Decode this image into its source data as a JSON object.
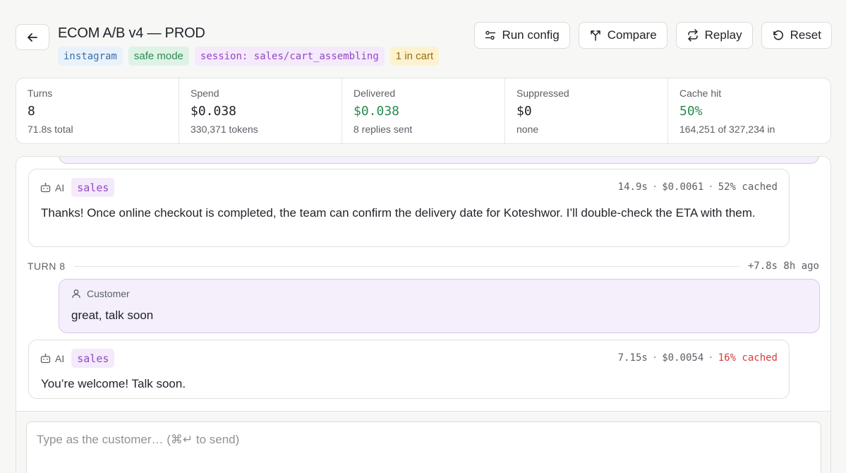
{
  "header": {
    "title": "ECOM A/B v4 — PROD",
    "tags": {
      "channel": "instagram",
      "mode": "safe mode",
      "session": "session: sales/cart_assembling",
      "cart": "1 in cart"
    },
    "actions": {
      "run_config": "Run config",
      "compare": "Compare",
      "replay": "Replay",
      "reset": "Reset"
    }
  },
  "stats": [
    {
      "label": "Turns",
      "value": "8",
      "sub": "71.8s total"
    },
    {
      "label": "Spend",
      "value": "$0.038",
      "sub": "330,371 tokens"
    },
    {
      "label": "Delivered",
      "value": "$0.038",
      "sub": "8 replies sent"
    },
    {
      "label": "Suppressed",
      "value": "$0",
      "sub": "none"
    },
    {
      "label": "Cache hit",
      "value": "50%",
      "sub": "164,251 of 327,234 in"
    }
  ],
  "colors": {
    "green_value": "#2a8a52",
    "agent_badge_text": "#9348c4",
    "customer_bubble": "#f5effc",
    "low_cache_red": "#d43b3b"
  },
  "conversation": {
    "ai_message_1": {
      "role": "AI",
      "agent": "sales",
      "duration": "14.9s",
      "cost": "$0.0061",
      "cached": "52% cached",
      "text": "Thanks! Once online checkout is completed, the team can confirm the delivery date for Koteshwor. I’ll double-check the ETA with them."
    },
    "turn": {
      "label": "TURN 8",
      "meta": "+7.8s 8h ago"
    },
    "customer_message": {
      "role": "Customer",
      "text": "great, talk soon"
    },
    "ai_message_2": {
      "role": "AI",
      "agent": "sales",
      "duration": "7.15s",
      "cost": "$0.0054",
      "cached": "16% cached",
      "text": "You’re welcome! Talk soon."
    },
    "composer": {
      "placeholder": "Type as the customer… (⌘↵ to send)"
    }
  }
}
